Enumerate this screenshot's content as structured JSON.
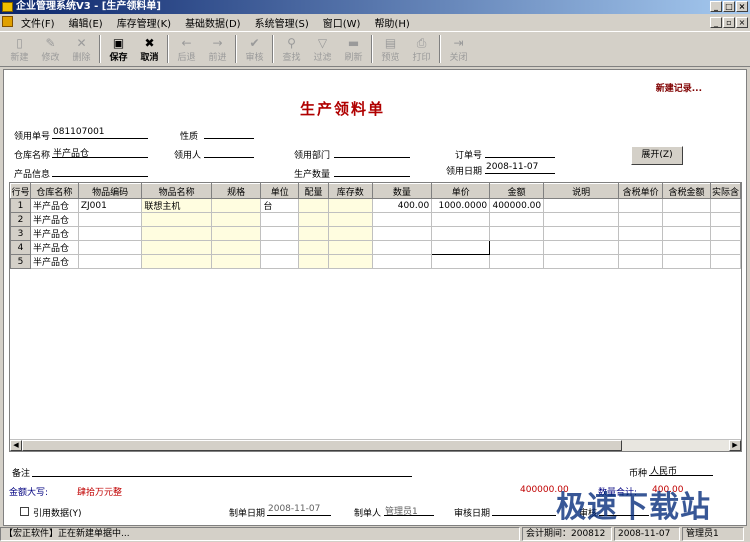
{
  "window": {
    "title": "企业管理系统V3 - [生产领料单]"
  },
  "menu": [
    "文件(F)",
    "编辑(E)",
    "库存管理(K)",
    "基础数据(D)",
    "系统管理(S)",
    "窗口(W)",
    "帮助(H)"
  ],
  "toolbar": [
    {
      "label": "新建",
      "icon": "new-doc-icon",
      "glyph": "▯",
      "enabled": false
    },
    {
      "label": "修改",
      "icon": "edit-icon",
      "glyph": "✎",
      "enabled": false
    },
    {
      "label": "删除",
      "icon": "delete-icon",
      "glyph": "✕",
      "enabled": false
    },
    {
      "label": "保存",
      "icon": "save-icon",
      "glyph": "▣",
      "enabled": true
    },
    {
      "label": "取消",
      "icon": "cancel-icon",
      "glyph": "✖",
      "enabled": true
    },
    {
      "label": "后退",
      "icon": "back-arrow-icon",
      "glyph": "←",
      "enabled": false
    },
    {
      "label": "前进",
      "icon": "forward-arrow-icon",
      "glyph": "→",
      "enabled": false
    },
    {
      "label": "审核",
      "icon": "check-icon",
      "glyph": "✔",
      "enabled": false
    },
    {
      "label": "查找",
      "icon": "binoculars-icon",
      "glyph": "⚲",
      "enabled": false
    },
    {
      "label": "过滤",
      "icon": "filter-icon",
      "glyph": "▽",
      "enabled": false
    },
    {
      "label": "刷新",
      "icon": "refresh-icon",
      "glyph": "▬",
      "enabled": false
    },
    {
      "label": "预览",
      "icon": "preview-icon",
      "glyph": "▤",
      "enabled": false
    },
    {
      "label": "打印",
      "icon": "printer-icon",
      "glyph": "⎙",
      "enabled": false
    },
    {
      "label": "关闭",
      "icon": "close-door-icon",
      "glyph": "⇥",
      "enabled": false
    }
  ],
  "form": {
    "status": "新建记录...",
    "title": "生产领料单",
    "fields": {
      "requisition_no_label": "领用单号",
      "requisition_no": "081107001",
      "nature_label": "性质",
      "nature": "",
      "warehouse_label": "仓库名称",
      "warehouse": "半产品仓",
      "receiver_label": "领用人",
      "receiver": "",
      "dept_label": "领用部门",
      "dept": "",
      "order_no_label": "订单号",
      "order_no": "",
      "product_info_label": "产品信息",
      "product_info": "",
      "prod_qty_label": "生产数量",
      "prod_qty": "",
      "date_label": "领用日期",
      "date": "2008-11-07"
    },
    "expand_button": "展开(Z)"
  },
  "grid": {
    "columns": [
      "行号",
      "仓库名称",
      "物品编码",
      "物品名称",
      "规格",
      "单位",
      "配量",
      "库存数",
      "数量",
      "单价",
      "金额",
      "说明",
      "含税单价",
      "含税金额",
      "实际含"
    ],
    "rows": [
      [
        "1",
        "半产品仓",
        "ZJ001",
        "联想主机",
        "",
        "台",
        "",
        "",
        "400.00",
        "1000.0000",
        "400000.00",
        "",
        "",
        "",
        ""
      ],
      [
        "2",
        "半产品仓",
        "",
        "",
        "",
        "",
        "",
        "",
        "",
        "",
        "",
        "",
        "",
        "",
        ""
      ],
      [
        "3",
        "半产品仓",
        "",
        "",
        "",
        "",
        "",
        "",
        "",
        "",
        "",
        "",
        "",
        "",
        ""
      ],
      [
        "4",
        "半产品仓",
        "",
        "",
        "",
        "",
        "",
        "",
        "",
        "",
        "",
        "",
        "",
        "",
        ""
      ],
      [
        "5",
        "半产品仓",
        "",
        "",
        "",
        "",
        "",
        "",
        "",
        "",
        "",
        "",
        "",
        "",
        ""
      ]
    ]
  },
  "footer": {
    "remark_label": "备注",
    "remark": "",
    "currency_label": "币种",
    "currency": "人民币",
    "amount_words_label": "金额大写:",
    "amount_words": "肆拾万元整",
    "amount_total": "400000.00",
    "qty_total_label": "数量合计:",
    "qty_total": "400.00",
    "cite_label": "引用数据(Y)",
    "made_date_label": "制单日期",
    "made_date": "2008-11-07",
    "maker_label": "制单人",
    "maker": "管理员1",
    "audit_date_label": "审核日期",
    "audit_date": "",
    "auditor_label": "审核",
    "auditor": ""
  },
  "statusbar": {
    "company": "【宏正软件】正在新建单据中...",
    "period": "会计期间：200812",
    "date": "2008-11-07",
    "user": "管理员1"
  },
  "watermark": "极速下载站",
  "colors": {
    "title_red": "#b00000",
    "amount_red": "#c00000",
    "grid_yellow": "#fffde0"
  }
}
